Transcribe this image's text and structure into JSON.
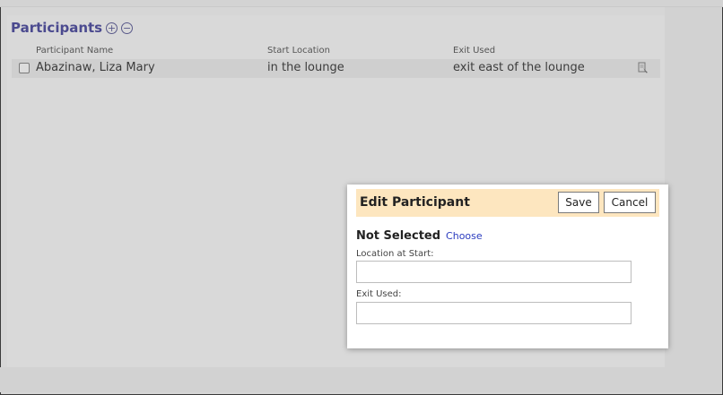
{
  "participants": {
    "title": "Participants",
    "add_icon": "plus-circle-icon",
    "remove_icon": "minus-circle-icon",
    "columns": [
      "Participant Name",
      "Start Location",
      "Exit Used"
    ],
    "rows": [
      {
        "name": "Abazinaw, Liza Mary",
        "start_location": "in the lounge",
        "exit_used": "exit east of the lounge",
        "checked": false,
        "edit_icon": "edit-document-icon"
      }
    ]
  },
  "edit_dialog": {
    "title": "Edit Participant",
    "save_label": "Save",
    "cancel_label": "Cancel",
    "selection_status": "Not Selected",
    "choose_label": "Choose",
    "location_label": "Location at Start:",
    "location_value": "",
    "exit_label": "Exit Used:",
    "exit_value": ""
  },
  "colors": {
    "title": "#4b4a8f",
    "dialog_header": "#fde6bf",
    "link": "#2a3bbf",
    "overlay_bg": "#d6d6d6"
  }
}
